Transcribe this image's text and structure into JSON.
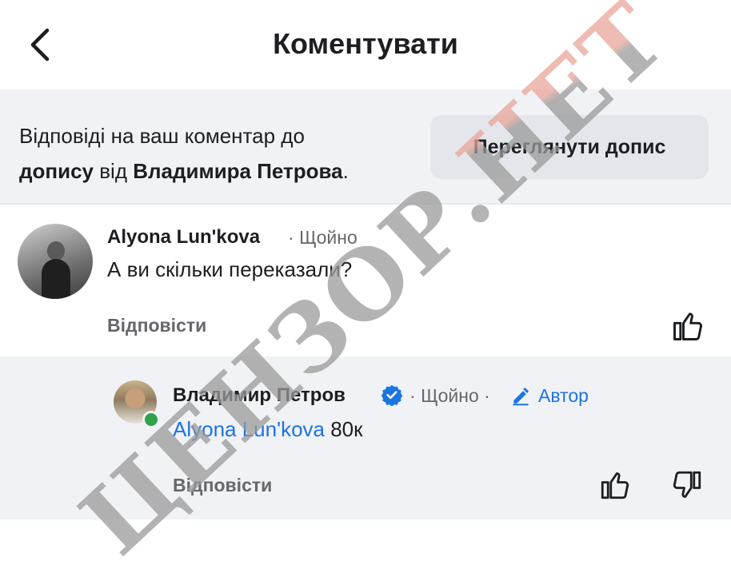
{
  "header": {
    "title": "Коментувати"
  },
  "notice": {
    "text_prefix": "Відповіді на ваш коментар до",
    "post_word": "допису",
    "from_word": " від ",
    "author": "Владимира Петрова",
    "period": ".",
    "view_post_label": "Переглянути допис"
  },
  "comments": [
    {
      "name": "Alyona Lun'kova",
      "separator": "·",
      "time": "Щойно",
      "text": "А ви скільки переказали?",
      "reply_label": "Відповісти"
    },
    {
      "name": "Владимир Петров",
      "separator": "·",
      "time": "Щойно",
      "author_badge": "Автор",
      "mention": "Alyona Lun'kova",
      "text": " 80к",
      "reply_label": "Відповісти"
    }
  ],
  "watermark": {
    "text": "ЦЕНЗОР.НЕТ"
  },
  "icons": {
    "back": "chevron-left-icon",
    "like": "thumbs-up-icon",
    "dislike": "thumbs-down-icon",
    "verified": "verified-badge-icon",
    "author": "pencil-icon"
  },
  "colors": {
    "link": "#1b74e4",
    "secondary": "#65676b",
    "online": "#31a24c",
    "watermark": "#b0b0b0",
    "watermark_accent": "#e8a59a"
  }
}
